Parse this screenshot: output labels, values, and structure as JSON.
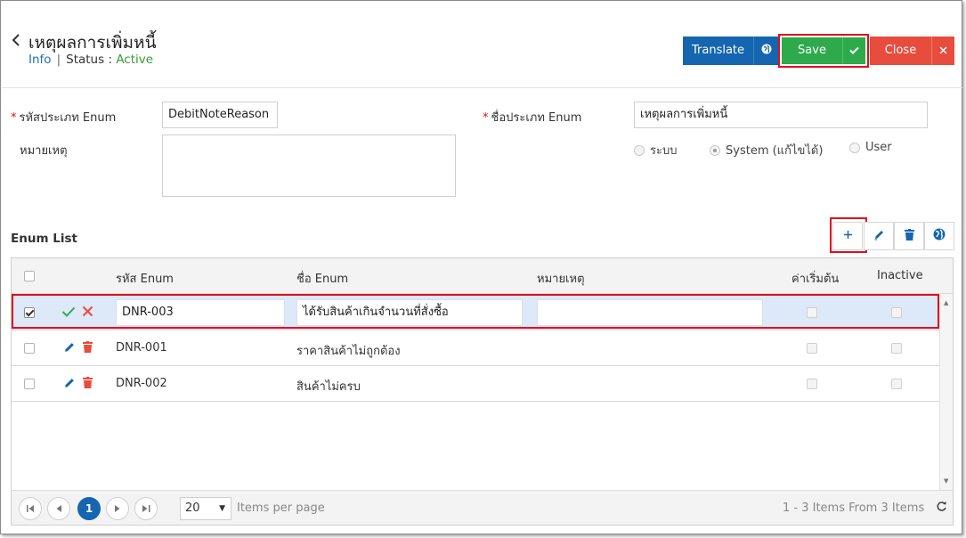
{
  "header": {
    "title": "เหตุผลการเพิ่มหนี้",
    "info_link": "Info",
    "separator": "|",
    "status_label": "Status",
    "status_colon": ":",
    "status_value": "Active"
  },
  "actions": {
    "translate_label": "Translate",
    "save_label": "Save",
    "close_label": "Close"
  },
  "form": {
    "enum_code_label": "รหัสประเภท Enum",
    "enum_code_value": "DebitNoteReason",
    "enum_name_label": "ชื่อประเภท Enum",
    "enum_name_value": "เหตุผลการเพิ่มหนี้",
    "remark_label": "หมายเหตุ",
    "remark_value": "",
    "required_mark": "*",
    "radio_options": [
      {
        "label": "ระบบ",
        "selected": false
      },
      {
        "label": "System (แก้ไขได้)",
        "selected": true
      },
      {
        "label": "User",
        "selected": false
      }
    ]
  },
  "enum_list": {
    "title": "Enum List",
    "columns": [
      "รหัส Enum",
      "ชื่อ Enum",
      "หมายเหตุ",
      "ค่าเริ่มต้น",
      "Inactive"
    ],
    "rows": [
      {
        "code": "DNR-003",
        "name": "ได้รับสินค้าเกินจำนวนที่สั่งซื้อ",
        "remark": "",
        "default": false,
        "inactive": false,
        "selected": true,
        "editing": true
      },
      {
        "code": "DNR-001",
        "name": "ราคาสินค้าไม่ถูกต้อง",
        "remark": "",
        "default": false,
        "inactive": false,
        "selected": false,
        "editing": false
      },
      {
        "code": "DNR-002",
        "name": "สินค้าไม่ครบ",
        "remark": "",
        "default": false,
        "inactive": false,
        "selected": false,
        "editing": false
      }
    ]
  },
  "pager": {
    "current_page": "1",
    "page_size": "20",
    "items_per_page_label": "Items per page",
    "summary": "1 - 3 Items From 3 Items"
  },
  "colors": {
    "primary": "#1565b0",
    "success": "#2eaa4c",
    "danger": "#e84c3d",
    "highlight": "#e00d1c",
    "status_active": "#3a9a3a",
    "row_edit_bg": "#dde8f8"
  },
  "icons": [
    "chevron-left-icon",
    "globe-icon",
    "check-icon",
    "close-icon",
    "plus-icon",
    "pencil-icon",
    "trash-icon",
    "refresh-icon"
  ]
}
